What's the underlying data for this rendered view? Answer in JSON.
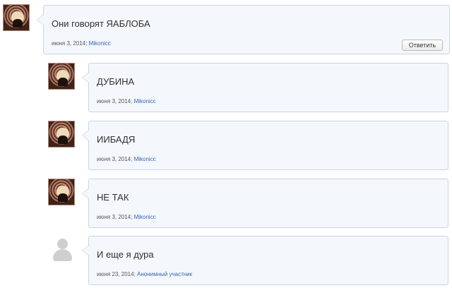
{
  "comments": [
    {
      "text": "Они говорят ЯАБЛОБА",
      "date": "июня 3, 2014; ",
      "author": "Mikonicc",
      "reply_label": "Ответить"
    },
    {
      "text": "ДУБИНА",
      "date": "июня 3, 2014; ",
      "author": "Mikonicc"
    },
    {
      "text": "ИИБАДЯ",
      "date": "июня 3, 2014; ",
      "author": "Mikonicc"
    },
    {
      "text": "НЕ ТАК",
      "date": "июня 3, 2014; ",
      "author": "Mikonicc"
    },
    {
      "text": "И еще я дура",
      "date": "июня 23, 2014; ",
      "author": "Анонимный участник"
    }
  ]
}
